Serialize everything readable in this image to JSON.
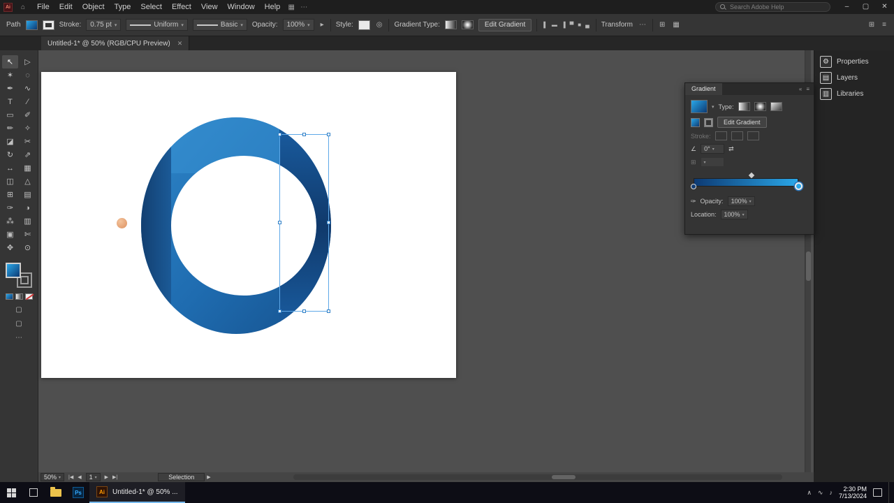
{
  "titlebar": {
    "menus": [
      "File",
      "Edit",
      "Object",
      "Type",
      "Select",
      "Effect",
      "View",
      "Window",
      "Help"
    ],
    "search_placeholder": "Search Adobe Help"
  },
  "icons": {
    "ai_logo": "Ai",
    "ps_logo": "Ps",
    "home": "⌂",
    "workspace": "▦",
    "arrange_documents": "⊞",
    "minimize": "–",
    "maximize": "▢",
    "close": "✕",
    "recolor": "◎",
    "panel_launcher": "▸",
    "collapse": "«",
    "panel_menu": "≡",
    "angle": "∠",
    "reverse": "⇄",
    "eyedropper": "✑",
    "grid": "⊞",
    "nav_first": "|◀",
    "nav_prev": "◀",
    "nav_next": "▶",
    "nav_last": "▶|",
    "status_fwd": "▶",
    "tray_chevron": "∧",
    "tray_network": "∿",
    "tray_volume": "♪",
    "more": "⋯",
    "screen_mode": "▢"
  },
  "controlbar": {
    "context_label": "Path",
    "stroke_label": "Stroke:",
    "stroke_value": "0.75 pt",
    "width_profile": "Uniform",
    "brush_definition": "Basic",
    "opacity_label": "Opacity:",
    "opacity_value": "100%",
    "style_label": "Style:",
    "gradient_type_label": "Gradient Type:",
    "edit_gradient_label": "Edit Gradient",
    "transform_label": "Transform",
    "align_icons": [
      {
        "name": "align-left",
        "glyph": "▌"
      },
      {
        "name": "align-center-horizontal",
        "glyph": "▬"
      },
      {
        "name": "align-right",
        "glyph": "▐"
      },
      {
        "name": "align-top",
        "glyph": "▀"
      },
      {
        "name": "align-center-vertical",
        "glyph": "■"
      },
      {
        "name": "align-bottom",
        "glyph": "▄"
      }
    ]
  },
  "tab": {
    "title": "Untitled-1* @ 50% (RGB/CPU Preview)"
  },
  "tools": [
    {
      "name": "selection",
      "glyph": "↖",
      "active": true
    },
    {
      "name": "direct-selection",
      "glyph": "▷"
    },
    {
      "name": "magic-wand",
      "glyph": "✶"
    },
    {
      "name": "lasso",
      "glyph": "◌"
    },
    {
      "name": "pen",
      "glyph": "✒"
    },
    {
      "name": "curvature",
      "glyph": "∿"
    },
    {
      "name": "type",
      "glyph": "T"
    },
    {
      "name": "line-segment",
      "glyph": "∕"
    },
    {
      "name": "rectangle",
      "glyph": "▭"
    },
    {
      "name": "paintbrush",
      "glyph": "✐"
    },
    {
      "name": "pencil",
      "glyph": "✏"
    },
    {
      "name": "shaper",
      "glyph": "✧"
    },
    {
      "name": "eraser",
      "glyph": "◪"
    },
    {
      "name": "scissors",
      "glyph": "✂"
    },
    {
      "name": "rotate",
      "glyph": "↻"
    },
    {
      "name": "scale",
      "glyph": "⇗"
    },
    {
      "name": "width",
      "glyph": "↔"
    },
    {
      "name": "free-transform",
      "glyph": "▦"
    },
    {
      "name": "shape-builder",
      "glyph": "◫"
    },
    {
      "name": "perspective-grid",
      "glyph": "△"
    },
    {
      "name": "mesh",
      "glyph": "⊞"
    },
    {
      "name": "gradient",
      "glyph": "▤"
    },
    {
      "name": "eyedropper",
      "glyph": "✑"
    },
    {
      "name": "blend",
      "glyph": "◑"
    },
    {
      "name": "symbol-sprayer",
      "glyph": "⁂"
    },
    {
      "name": "column-graph",
      "glyph": "▥"
    },
    {
      "name": "artboard",
      "glyph": "▣"
    },
    {
      "name": "slice",
      "glyph": "✄"
    },
    {
      "name": "hand",
      "glyph": "✥"
    },
    {
      "name": "zoom",
      "glyph": "⊙"
    }
  ],
  "gradient_panel": {
    "title": "Gradient",
    "type_label": "Type:",
    "edit_gradient_label": "Edit Gradient",
    "stroke_label": "Stroke:",
    "angle_value": "0°",
    "opacity_label": "Opacity:",
    "opacity_value": "100%",
    "location_label": "Location:",
    "location_value": "100%",
    "gradient_start_color": "#0d3a73",
    "gradient_end_color": "#2aa7e8"
  },
  "right_dock": {
    "panels": [
      {
        "name": "properties",
        "label": "Properties",
        "glyph": "⚙"
      },
      {
        "name": "layers",
        "label": "Layers",
        "glyph": "▤"
      },
      {
        "name": "libraries",
        "label": "Libraries",
        "glyph": "▥"
      }
    ]
  },
  "statusbar": {
    "zoom": "50%",
    "artboard_number": "1",
    "status": "Selection"
  },
  "taskbar": {
    "illustrator_label": "Untitled-1* @ 50% ...",
    "time": "2:30 PM",
    "date": "7/13/2024"
  },
  "artwork": {
    "logo_ring_colors": [
      "#2e86c9",
      "#1f6cb0",
      "#15518d"
    ],
    "logo_stem_colors": [
      "#123e6f",
      "#1b5a97"
    ],
    "logo_crescent_colors": [
      "#1a5fa4",
      "#10396b"
    ],
    "accent_dot_color": "#d9854e"
  }
}
